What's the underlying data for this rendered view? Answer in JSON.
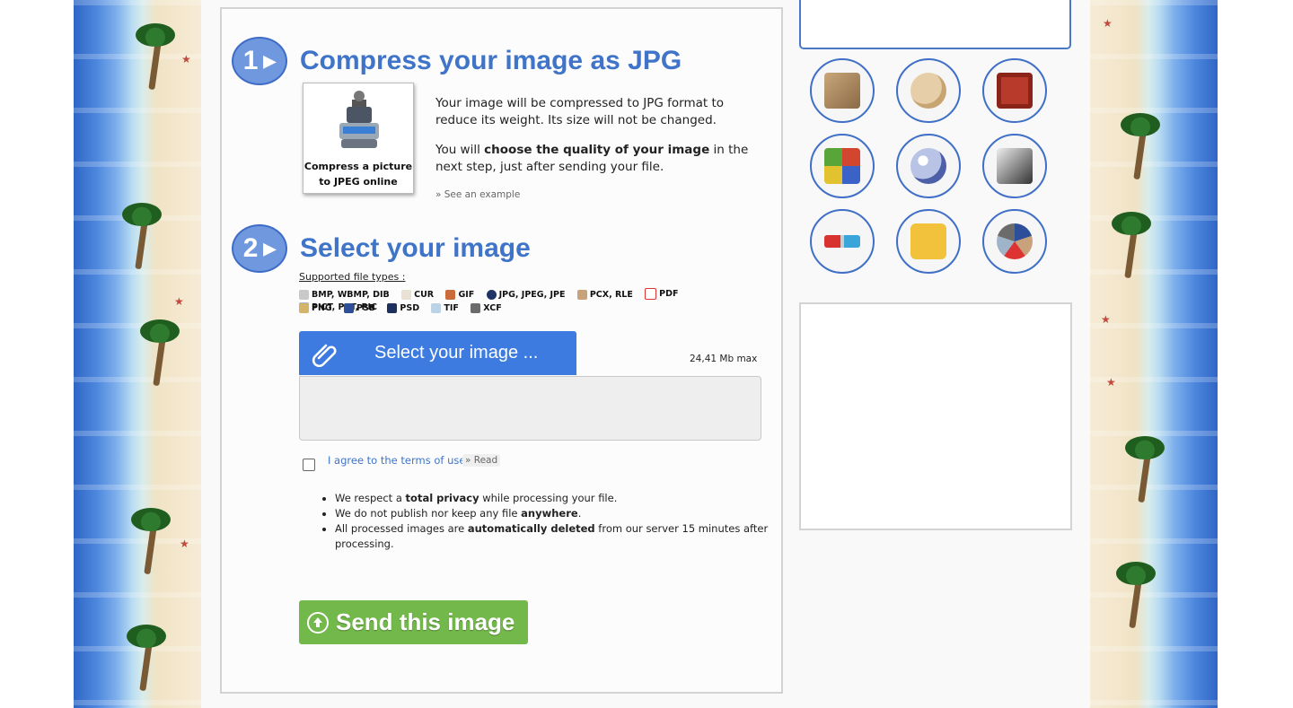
{
  "step1": {
    "number": "1",
    "title": "Compress your image as JPG",
    "image_caption_line1": "Compress a picture",
    "image_caption_line2": "to JPEG online",
    "para1": "Your image will be compressed to JPG format to reduce its weight. Its size will not be changed.",
    "para2_before": "You will ",
    "para2_bold": "choose the quality of your image",
    "para2_after": " in the next step, just after sending your file.",
    "see_example": "» See an example"
  },
  "step2": {
    "number": "2",
    "title": "Select your image",
    "supported_label": "Supported file types :",
    "filetypes_row1": [
      "BMP, WBMP, DIB",
      "CUR",
      "GIF",
      "JPG, JPEG, JPE",
      "PCX, RLE",
      "PDF",
      "PICT, PCT, PIC"
    ],
    "filetypes_row2": [
      "PNG",
      "PSB",
      "PSD",
      "TIF",
      "XCF"
    ],
    "select_button": "Select your image ...",
    "max_size": "24,41 Mb max",
    "agree_text": "I agree to the terms of use",
    "read_link": "» Read",
    "privacy": [
      {
        "before": "We respect a ",
        "bold": "total privacy",
        "after": " while processing your file."
      },
      {
        "before": "We do not publish nor keep any file ",
        "bold": "anywhere",
        "after": "."
      },
      {
        "before": "All processed images are ",
        "bold": "automatically deleted",
        "after": " from our server 15 minutes after processing."
      }
    ],
    "send_button": "Send this image"
  },
  "colors": {
    "accent_blue": "#3f74c9",
    "button_blue": "#3d7be0",
    "send_green": "#72b84a"
  },
  "sidebar_tools": [
    {
      "icon": "sepia-photo-icon"
    },
    {
      "icon": "paint-palette-icon"
    },
    {
      "icon": "retro-tv-icon"
    },
    {
      "icon": "pop-art-icon"
    },
    {
      "icon": "disco-ball-icon"
    },
    {
      "icon": "pencil-sketch-icon"
    },
    {
      "icon": "3d-glasses-icon"
    },
    {
      "icon": "rotate-image-icon"
    },
    {
      "icon": "file-formats-icon"
    }
  ]
}
